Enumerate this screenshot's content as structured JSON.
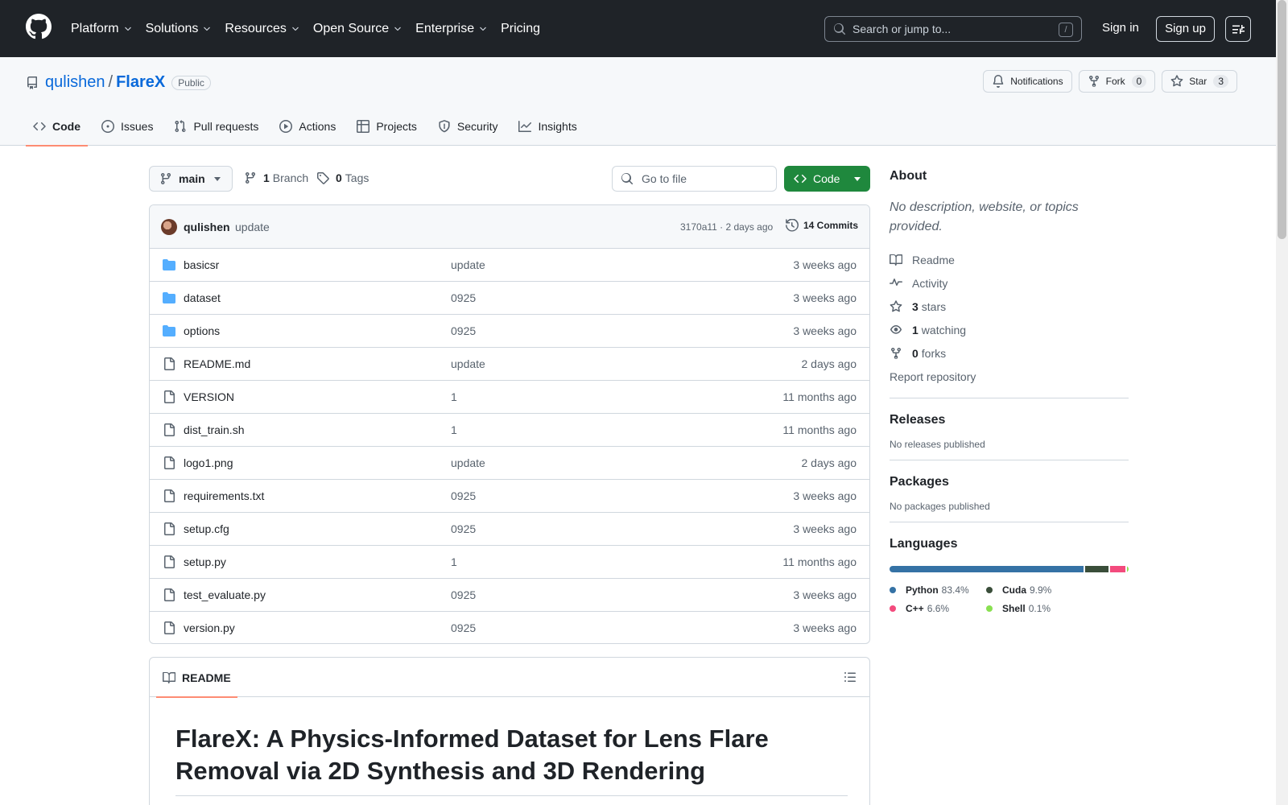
{
  "header": {
    "nav": [
      {
        "label": "Platform",
        "dropdown": true
      },
      {
        "label": "Solutions",
        "dropdown": true
      },
      {
        "label": "Resources",
        "dropdown": true
      },
      {
        "label": "Open Source",
        "dropdown": true
      },
      {
        "label": "Enterprise",
        "dropdown": true
      },
      {
        "label": "Pricing",
        "dropdown": false
      }
    ],
    "search_placeholder": "Search or jump to...",
    "search_shortcut": "/",
    "sign_in": "Sign in",
    "sign_up": "Sign up"
  },
  "repo": {
    "owner": "qulishen",
    "separator": "/",
    "name": "FlareX",
    "visibility": "Public",
    "notifications_label": "Notifications",
    "fork_label": "Fork",
    "fork_count": "0",
    "star_label": "Star",
    "star_count": "3",
    "tabs": [
      {
        "label": "Code",
        "icon": "code-icon",
        "active": true
      },
      {
        "label": "Issues",
        "icon": "issue-icon",
        "active": false
      },
      {
        "label": "Pull requests",
        "icon": "pull-request-icon",
        "active": false
      },
      {
        "label": "Actions",
        "icon": "play-icon",
        "active": false
      },
      {
        "label": "Projects",
        "icon": "table-icon",
        "active": false
      },
      {
        "label": "Security",
        "icon": "shield-icon",
        "active": false
      },
      {
        "label": "Insights",
        "icon": "graph-icon",
        "active": false
      }
    ]
  },
  "branch_bar": {
    "branch": "main",
    "branch_count": "1",
    "branch_label": "Branch",
    "tag_count": "0",
    "tag_label": "Tags",
    "goto_placeholder": "Go to file",
    "code_button": "Code"
  },
  "commit": {
    "author": "qulishen",
    "message": "update",
    "meta": "3170a11 · 2 days ago",
    "count_label": "14 Commits"
  },
  "files": [
    {
      "name": "basicsr",
      "type": "folder",
      "message": "update",
      "date": "3 weeks ago"
    },
    {
      "name": "dataset",
      "type": "folder",
      "message": "0925",
      "date": "3 weeks ago"
    },
    {
      "name": "options",
      "type": "folder",
      "message": "0925",
      "date": "3 weeks ago"
    },
    {
      "name": "README.md",
      "type": "file",
      "message": "update",
      "date": "2 days ago"
    },
    {
      "name": "VERSION",
      "type": "file",
      "message": "1",
      "date": "11 months ago"
    },
    {
      "name": "dist_train.sh",
      "type": "file",
      "message": "1",
      "date": "11 months ago"
    },
    {
      "name": "logo1.png",
      "type": "file",
      "message": "update",
      "date": "2 days ago"
    },
    {
      "name": "requirements.txt",
      "type": "file",
      "message": "0925",
      "date": "3 weeks ago"
    },
    {
      "name": "setup.cfg",
      "type": "file",
      "message": "0925",
      "date": "3 weeks ago"
    },
    {
      "name": "setup.py",
      "type": "file",
      "message": "1",
      "date": "11 months ago"
    },
    {
      "name": "test_evaluate.py",
      "type": "file",
      "message": "0925",
      "date": "3 weeks ago"
    },
    {
      "name": "version.py",
      "type": "file",
      "message": "0925",
      "date": "3 weeks ago"
    }
  ],
  "readme": {
    "tab_label": "README",
    "title": "FlareX: A Physics-Informed Dataset for Lens Flare Removal via 2D Synthesis and 3D Rendering"
  },
  "sidebar": {
    "about_title": "About",
    "about_desc": "No description, website, or topics provided.",
    "readme": "Readme",
    "activity": "Activity",
    "stars_count": "3",
    "stars_label": "stars",
    "watching_count": "1",
    "watching_label": "watching",
    "forks_count": "0",
    "forks_label": "forks",
    "report": "Report repository",
    "releases_title": "Releases",
    "releases_text": "No releases published",
    "packages_title": "Packages",
    "packages_text": "No packages published",
    "languages_title": "Languages",
    "languages": [
      {
        "name": "Python",
        "percent": "83.4%",
        "value": 83.4,
        "color": "#3572A5"
      },
      {
        "name": "Cuda",
        "percent": "9.9%",
        "value": 9.9,
        "color": "#3A4E3A"
      },
      {
        "name": "C++",
        "percent": "6.6%",
        "value": 6.6,
        "color": "#f34b7d"
      },
      {
        "name": "Shell",
        "percent": "0.1%",
        "value": 0.1,
        "color": "#89e051"
      }
    ]
  }
}
